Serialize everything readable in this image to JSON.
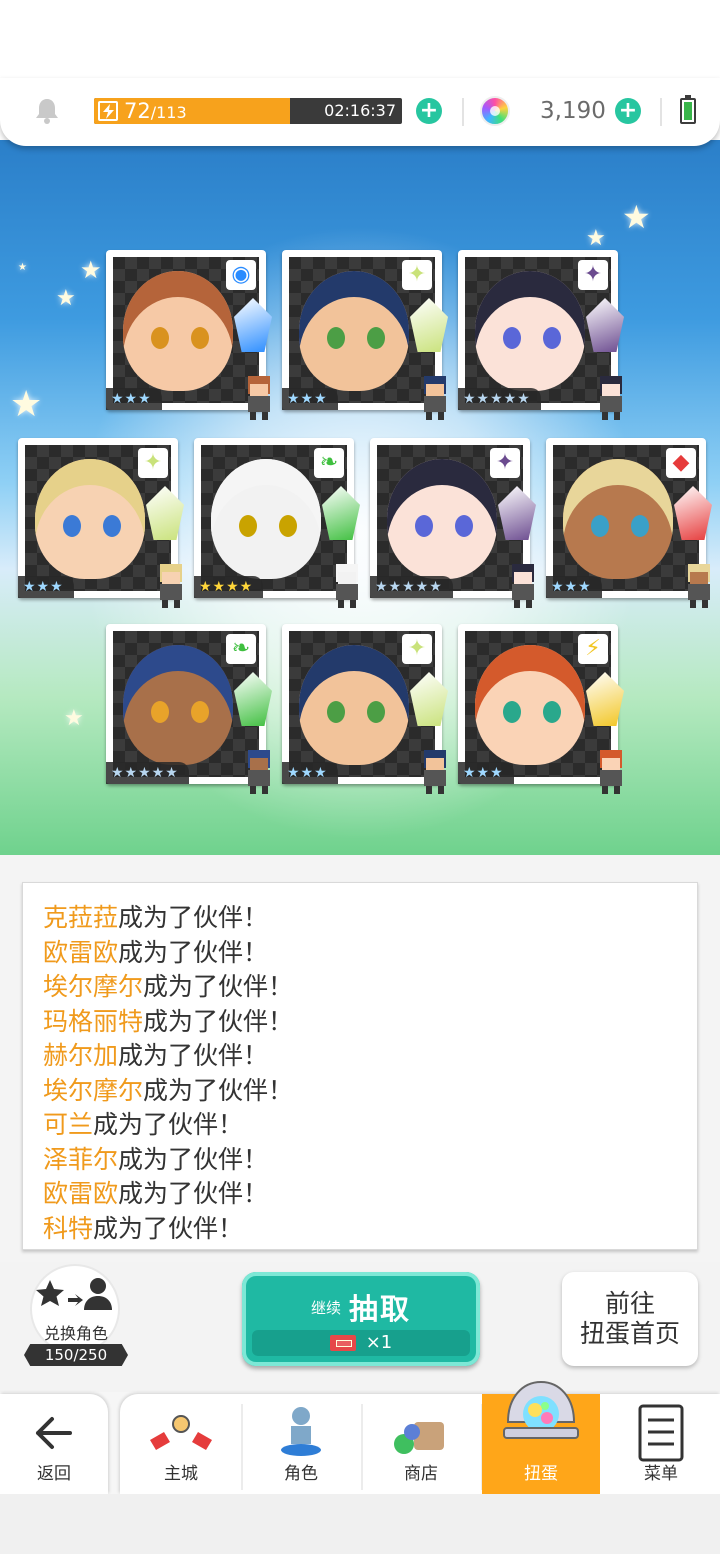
{
  "hud": {
    "stamina_current": "72",
    "stamina_max": "/113",
    "stamina_fraction": 0.637,
    "timer": "02:16:37",
    "gem_count": "3,190"
  },
  "cards": [
    {
      "rank": "★★★",
      "badge": "◉",
      "badge_color": "#2a8cff"
    },
    {
      "rank": "★★★",
      "badge": "✦",
      "badge_color": "#c9e27a"
    },
    {
      "rank": "★★★★★",
      "badge": "✦",
      "badge_color": "#6b4b8f"
    },
    {
      "rank": "★★★",
      "badge": "✦",
      "badge_color": "#c9e27a"
    },
    {
      "rank": "★★★★",
      "badge": "❧",
      "badge_color": "#3fbf3f"
    },
    {
      "rank": "★★★★★",
      "badge": "✦",
      "badge_color": "#6b4b8f"
    },
    {
      "rank": "★★★",
      "badge": "◆",
      "badge_color": "#e63b3b"
    },
    {
      "rank": "★★★★★",
      "badge": "❧",
      "badge_color": "#3fbf3f"
    },
    {
      "rank": "★★★",
      "badge": "✦",
      "badge_color": "#c9e27a"
    },
    {
      "rank": "★★★",
      "badge": "⚡",
      "badge_color": "#f2c623"
    }
  ],
  "log": [
    {
      "name": "克菈菈",
      "suffix": "成为了伙伴！"
    },
    {
      "name": "欧雷欧",
      "suffix": "成为了伙伴！"
    },
    {
      "name": "埃尔摩尔",
      "suffix": "成为了伙伴！"
    },
    {
      "name": "玛格丽特",
      "suffix": "成为了伙伴！"
    },
    {
      "name": "赫尔加",
      "suffix": "成为了伙伴！"
    },
    {
      "name": "埃尔摩尔",
      "suffix": "成为了伙伴！"
    },
    {
      "name": "可兰",
      "suffix": "成为了伙伴！"
    },
    {
      "name": "泽菲尔",
      "suffix": "成为了伙伴！"
    },
    {
      "name": "欧雷欧",
      "suffix": "成为了伙伴！"
    },
    {
      "name": "科特",
      "suffix": "成为了伙伴！"
    }
  ],
  "actions": {
    "exchange_label": "兑换角色",
    "exchange_count": "150/250",
    "draw_prefix": "继续",
    "draw_label": "抽取",
    "draw_cost": "×1",
    "goto_line1": "前往",
    "goto_line2": "扭蛋首页"
  },
  "nav": {
    "back": "返回",
    "tabs": [
      "主城",
      "角色",
      "商店",
      "扭蛋",
      "菜单"
    ],
    "active_tab": "扭蛋"
  }
}
